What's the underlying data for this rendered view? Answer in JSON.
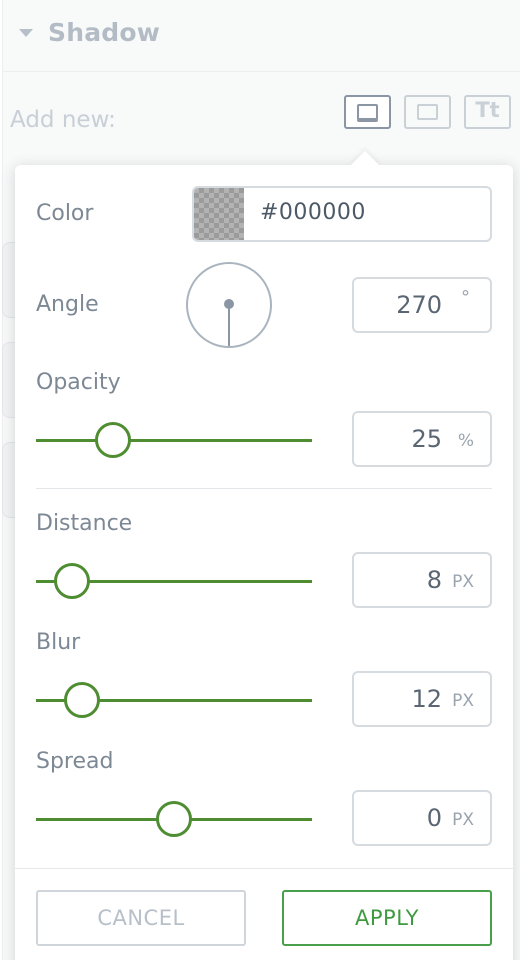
{
  "section": {
    "title": "Shadow",
    "caret_icon": "caret-down-icon"
  },
  "add_new": {
    "label": "Add new:",
    "buttons": [
      {
        "name": "drop-shadow",
        "icon": "drop-shadow-box-icon",
        "active": true
      },
      {
        "name": "inner-shadow",
        "icon": "inner-shadow-box-icon",
        "active": false
      },
      {
        "name": "text-shadow",
        "label": "Tt",
        "active": false
      }
    ]
  },
  "popover": {
    "color": {
      "label": "Color",
      "value": "#000000",
      "swatch": "transparent-checker"
    },
    "angle": {
      "label": "Angle",
      "value": "270",
      "unit": "°"
    },
    "opacity": {
      "label": "Opacity",
      "value": "25",
      "unit": "%",
      "slider_fraction": 0.25
    },
    "distance": {
      "label": "Distance",
      "value": "8",
      "unit": "PX",
      "slider_fraction": 0.13
    },
    "blur": {
      "label": "Blur",
      "value": "12",
      "unit": "PX",
      "slider_fraction": 0.17
    },
    "spread": {
      "label": "Spread",
      "value": "0",
      "unit": "PX",
      "slider_fraction": 0.5
    }
  },
  "actions": {
    "cancel_label": "CANCEL",
    "apply_label": "APPLY"
  },
  "colors": {
    "accent_green": "#4e8d31",
    "apply_green": "#3f9a3f",
    "border_grey": "#d6dbe0"
  }
}
